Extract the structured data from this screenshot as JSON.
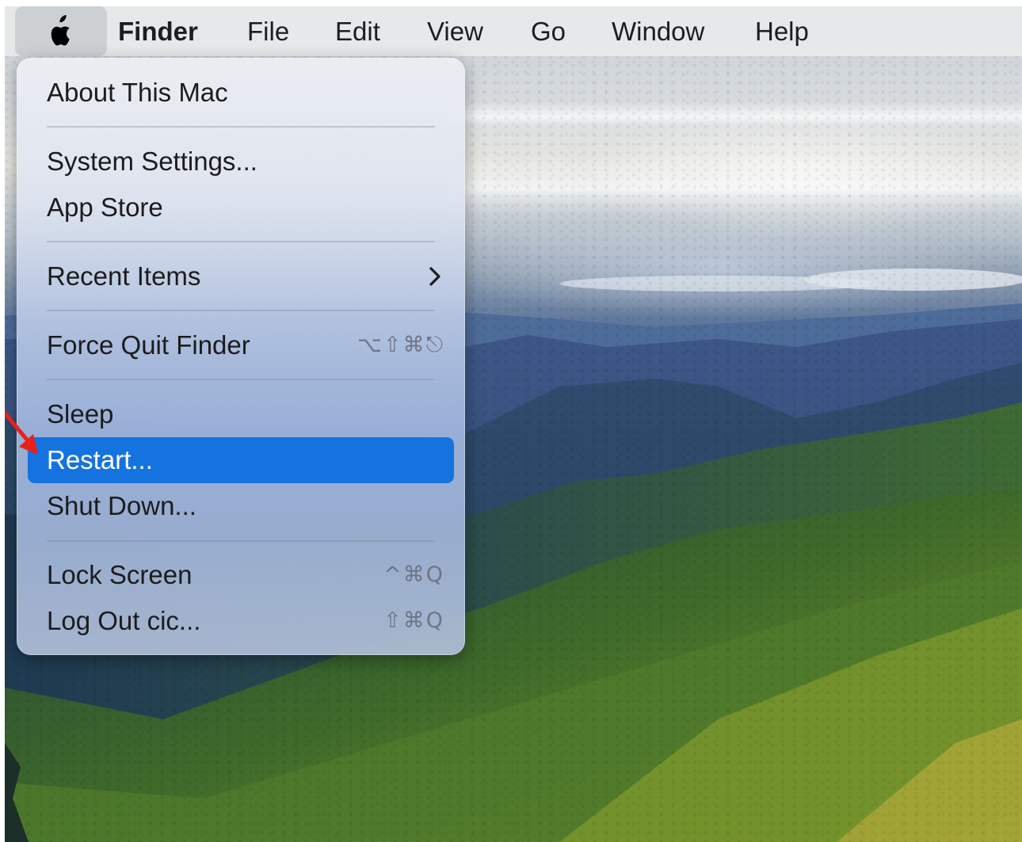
{
  "menubar": {
    "apple_icon": "apple-logo-icon",
    "items": [
      "Finder",
      "File",
      "Edit",
      "View",
      "Go",
      "Window",
      "Help"
    ]
  },
  "apple_menu": {
    "items": [
      {
        "label": "About This Mac"
      },
      {
        "label": "System Settings..."
      },
      {
        "label": "App Store"
      },
      {
        "label": "Recent Items",
        "submenu_icon": "chevron-right-icon"
      },
      {
        "label": "Force Quit Finder",
        "shortcut": "⌥⇧⌘⎋"
      },
      {
        "label": "Sleep"
      },
      {
        "label": "Restart...",
        "selected": true
      },
      {
        "label": "Shut Down..."
      },
      {
        "label": "Lock Screen",
        "shortcut": "^⌘Q"
      },
      {
        "label": "Log Out cic...",
        "shortcut": "⇧⌘Q"
      }
    ]
  },
  "annotation": {
    "icon": "red-arrow-icon",
    "color": "#e8201c"
  },
  "colors": {
    "selection": "#1573e0",
    "menubar": "#e8eaec"
  }
}
